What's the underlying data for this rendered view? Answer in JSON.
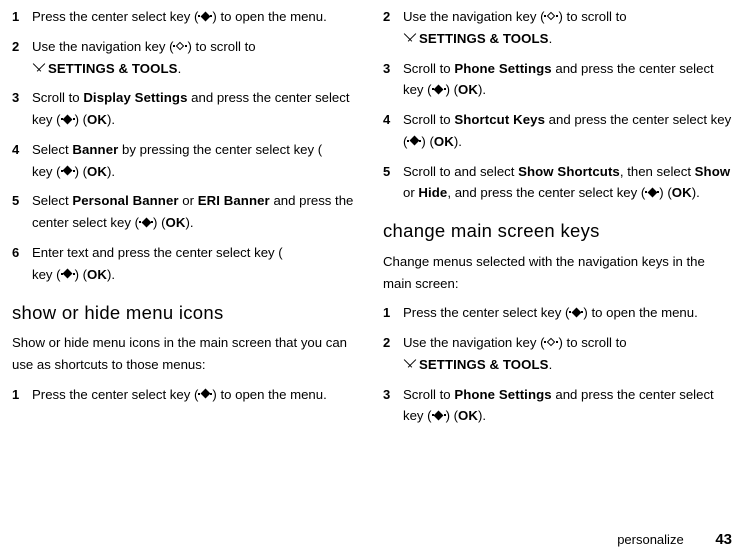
{
  "footer": {
    "section": "personalize",
    "page": "43"
  },
  "icons": {
    "center": "center-select-key",
    "nav": "navigation-key",
    "tools": "tools-icon"
  },
  "col1": {
    "s1": {
      "n": "1",
      "pre": "Press the center select key (",
      "post": ") to open the menu."
    },
    "s2": {
      "n": "2",
      "pre": "Use the navigation key (",
      "mid": ") to scroll to ",
      "opt": "SETTINGS & TOOLS",
      "post": "."
    },
    "s3": {
      "n": "3",
      "a": "Scroll to ",
      "b": "Display Settings",
      "c": " and press the center select key (",
      "ok": "OK",
      "d": ") (",
      "e": ")."
    },
    "s4": {
      "n": "4",
      "a": "Select ",
      "b": "Banner",
      "c": " by pressing the center select key (",
      "ok": "OK",
      "d": ") (",
      "e": ")."
    },
    "s5": {
      "n": "5",
      "a": "Select ",
      "b": "Personal Banner",
      "or": " or ",
      "b2": "ERI Banner",
      "c": " and press the center select key (",
      "ok": "OK",
      "d": ") (",
      "e": ")."
    },
    "s6": {
      "n": "6",
      "a": "Enter text and press the center select key (",
      "ok": "OK",
      "d": ") (",
      "e": ")."
    },
    "h2": "show or hide menu icons",
    "intro": "Show or hide menu icons in the main screen that you can use as shortcuts to those menus:",
    "s7": {
      "n": "1",
      "pre": "Press the center select key (",
      "post": ") to open the menu."
    }
  },
  "col2": {
    "s2": {
      "n": "2",
      "pre": "Use the navigation key (",
      "mid": ") to scroll to ",
      "opt": "SETTINGS & TOOLS",
      "post": "."
    },
    "s3": {
      "n": "3",
      "a": "Scroll to ",
      "b": "Phone Settings",
      "c": " and press the center select key (",
      "ok": "OK",
      "d": ") (",
      "e": ")."
    },
    "s4": {
      "n": "4",
      "a": "Scroll to ",
      "b": "Shortcut Keys",
      "c": " and press the center select key (",
      "ok": "OK",
      "d": ") (",
      "e": ")."
    },
    "s5": {
      "n": "5",
      "a": "Scroll to and select ",
      "b": "Show Shortcuts",
      "sel": ", then select ",
      "b2": "Show",
      "or": " or ",
      "b3": "Hide",
      "c": ", and press the center select key (",
      "ok": "OK",
      "d": ") (",
      "e": ")."
    },
    "h2": "change main screen keys",
    "intro": "Change menus selected with the navigation keys in the main screen:",
    "s1b": {
      "n": "1",
      "pre": "Press the center select key (",
      "post": ") to open the menu."
    },
    "s2b": {
      "n": "2",
      "pre": "Use the navigation key (",
      "mid": ") to scroll to ",
      "opt": "SETTINGS & TOOLS",
      "post": "."
    },
    "s3b": {
      "n": "3",
      "a": "Scroll to ",
      "b": "Phone Settings",
      "c": " and press the center select key (",
      "ok": "OK",
      "d": ") (",
      "e": ")."
    }
  }
}
